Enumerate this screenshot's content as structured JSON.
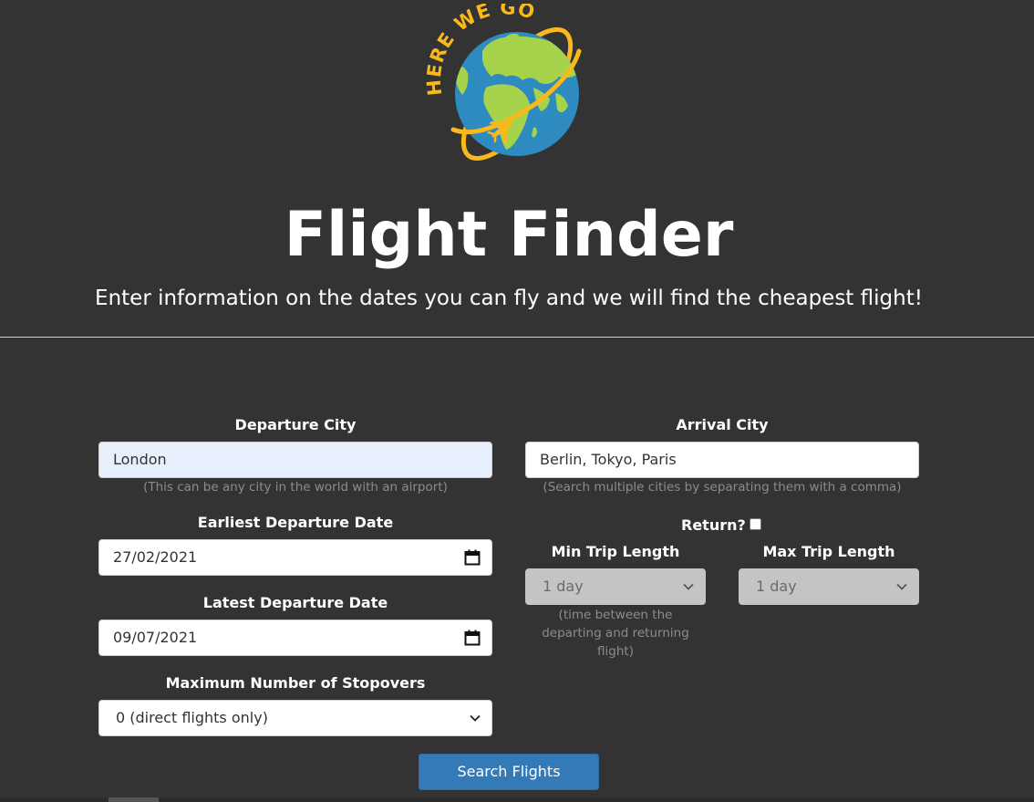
{
  "header": {
    "logo_text": "HERE WE GO!",
    "title": "Flight Finder",
    "subtitle": "Enter information on the dates you can fly and we will find the cheapest flight!"
  },
  "form": {
    "departure_city": {
      "label": "Departure City",
      "value": "London",
      "hint": "(This can be any city in the world with an airport)"
    },
    "arrival_city": {
      "label": "Arrival City",
      "value": "Berlin, Tokyo, Paris",
      "hint": "(Search multiple cities by separating them with a comma)"
    },
    "earliest_date": {
      "label": "Earliest Departure Date",
      "value": "27/02/2021"
    },
    "latest_date": {
      "label": "Latest Departure Date",
      "value": "09/07/2021"
    },
    "return": {
      "label": "Return?",
      "checked": false
    },
    "min_trip": {
      "label": "Min Trip Length",
      "value": "1 day",
      "hint_lines": [
        "(time between the",
        "departing and returning",
        "flight)"
      ]
    },
    "max_trip": {
      "label": "Max Trip Length",
      "value": "1 day"
    },
    "stopovers": {
      "label": "Maximum Number of Stopovers",
      "value": "0 (direct flights only)"
    },
    "submit_label": "Search Flights"
  },
  "icons": {
    "calendar": "calendar-icon",
    "chevron": "chevron-down-icon",
    "logo": "globe-airplane-logo"
  },
  "colors": {
    "background": "#333333",
    "button": "#337ab7",
    "logo_yellow": "#f9b81b",
    "ocean": "#2d8bc0",
    "land": "#a6d34b"
  }
}
